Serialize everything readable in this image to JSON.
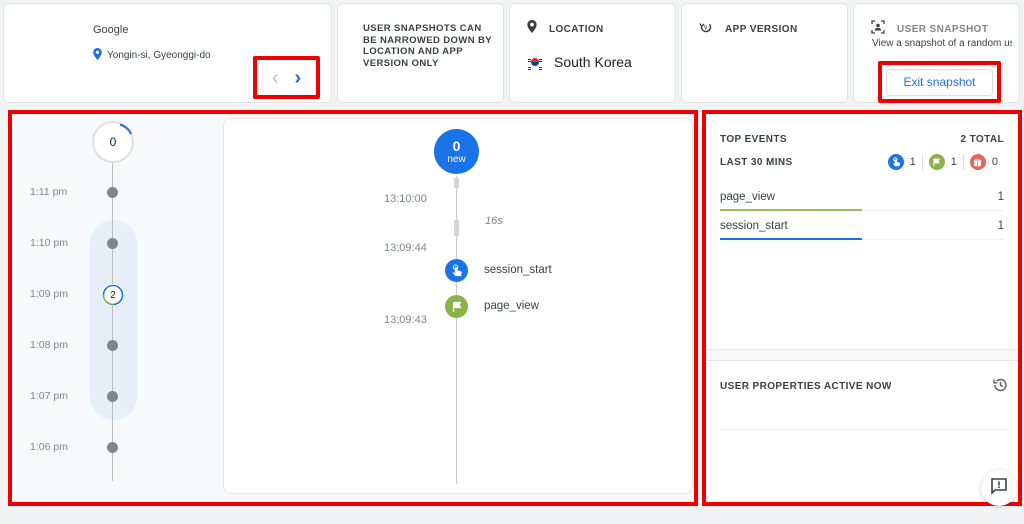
{
  "device": {
    "name": "Google",
    "location": "Yongin-si, Gyeonggi-do",
    "prev_icon": "chevron-left-icon",
    "next_icon": "chevron-right-icon",
    "prev_glyph": "‹",
    "next_glyph": "›"
  },
  "notice": {
    "text": "USER SNAPSHOTS CAN BE NARROWED DOWN BY LOCATION AND APP VERSION ONLY"
  },
  "location_card": {
    "label": "LOCATION",
    "icon": "location-pin-icon",
    "country": "South Korea",
    "flag": "south-korea-flag-icon"
  },
  "app_version_card": {
    "label": "APP VERSION",
    "icon": "app-version-icon"
  },
  "snapshot_card": {
    "label": "USER SNAPSHOT",
    "icon": "user-snapshot-icon",
    "description": "View a snapshot of a random user's activity st...",
    "exit_label": "Exit snapshot"
  },
  "minute_timeline": {
    "top_count": "0",
    "rows": [
      {
        "time": "1:11 pm",
        "count": null
      },
      {
        "time": "1:10 pm",
        "count": null
      },
      {
        "time": "1:09 pm",
        "count": "2"
      },
      {
        "time": "1:08 pm",
        "count": null
      },
      {
        "time": "1:07 pm",
        "count": null
      },
      {
        "time": "1:06 pm",
        "count": null
      }
    ]
  },
  "event_stream": {
    "new_count": "0",
    "new_label": "new",
    "timestamps": [
      "13:10:00",
      "13:09:44",
      "13:09:43"
    ],
    "gap": "16s",
    "events": [
      {
        "name": "session_start",
        "icon": "touch-icon",
        "color": "#1a73e8"
      },
      {
        "name": "page_view",
        "icon": "flag-icon",
        "color": "#8bb14a"
      }
    ]
  },
  "top_events": {
    "title": "TOP EVENTS",
    "total": "2 TOTAL",
    "period": "LAST 30 MINS",
    "type_counts": [
      {
        "icon": "touch-icon",
        "color": "#1a73e8",
        "value": "1"
      },
      {
        "icon": "flag-icon",
        "color": "#8bb14a",
        "value": "1"
      },
      {
        "icon": "gift-icon",
        "color": "#e8635b",
        "value": "0"
      }
    ],
    "rows": [
      {
        "name": "page_view",
        "value": "1",
        "color": "#9bbd5a",
        "share": 0.5
      },
      {
        "name": "session_start",
        "value": "1",
        "color": "#1a73e8",
        "share": 0.5
      }
    ]
  },
  "user_properties": {
    "title": "USER PROPERTIES ACTIVE NOW",
    "icon": "history-icon"
  },
  "feedback": {
    "icon": "feedback-icon"
  }
}
